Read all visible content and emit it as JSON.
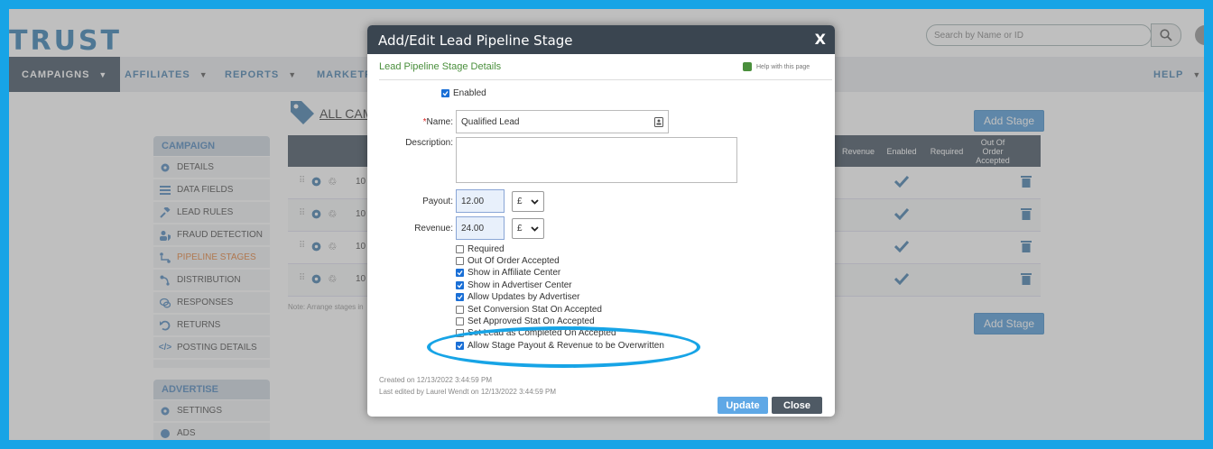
{
  "header": {
    "logo": "TRUST",
    "search_placeholder": "Search by Name or ID"
  },
  "nav": {
    "items": [
      {
        "label": "CAMPAIGNS",
        "active": true
      },
      {
        "label": "AFFILIATES"
      },
      {
        "label": "REPORTS"
      },
      {
        "label": "MARKETPL"
      },
      {
        "label": "HELP"
      }
    ]
  },
  "sidebar": {
    "campaign_head": "CAMPAIGN",
    "items": [
      {
        "label": "DETAILS",
        "icon": "gear-icon"
      },
      {
        "label": "DATA FIELDS",
        "icon": "list-icon"
      },
      {
        "label": "LEAD RULES",
        "icon": "gavel-icon"
      },
      {
        "label": "FRAUD DETECTION",
        "icon": "user-shield-icon"
      },
      {
        "label": "PIPELINE STAGES",
        "icon": "pipeline-icon",
        "active": true
      },
      {
        "label": "DISTRIBUTION",
        "icon": "distribution-icon"
      },
      {
        "label": "RESPONSES",
        "icon": "chat-icon"
      },
      {
        "label": "RETURNS",
        "icon": "return-icon"
      },
      {
        "label": "POSTING DETAILS",
        "icon": "code-icon"
      }
    ],
    "advertise_head": "ADVERTISE",
    "advertise_items": [
      {
        "label": "SETTINGS",
        "icon": "gear-icon"
      },
      {
        "label": "ADS",
        "icon": "palette-icon"
      }
    ]
  },
  "main": {
    "title": "ALL CAM",
    "add_stage": "Add Stage",
    "columns": {
      "revenue": "Revenue",
      "enabled": "Enabled",
      "required": "Required",
      "out_of_order": "Out Of Order Accepted"
    },
    "rows": [
      {
        "num": "10"
      },
      {
        "num": "10"
      },
      {
        "num": "10"
      },
      {
        "num": "10"
      }
    ],
    "note": "Note: Arrange stages in"
  },
  "modal": {
    "title": "Add/Edit Lead Pipeline Stage",
    "close": "X",
    "section": "Lead Pipeline Stage Details",
    "help": "Help with this page",
    "enabled_label": "Enabled",
    "name_label": "Name:",
    "name_required": "*",
    "name_value": "Qualified Lead",
    "description_label": "Description:",
    "payout_label": "Payout:",
    "payout_value": "12.00",
    "revenue_label": "Revenue:",
    "revenue_value": "24.00",
    "currency": "£",
    "checkboxes": [
      {
        "label": "Required",
        "checked": false
      },
      {
        "label": "Out Of Order Accepted",
        "checked": false
      },
      {
        "label": "Show in Affiliate Center",
        "checked": true
      },
      {
        "label": "Show in Advertiser Center",
        "checked": true
      },
      {
        "label": "Allow Updates by Advertiser",
        "checked": true
      },
      {
        "label": "Set Conversion Stat On Accepted",
        "checked": false
      },
      {
        "label": "Set Approved Stat On Accepted",
        "checked": false
      },
      {
        "label": "Set Lead as Completed On Accepted",
        "checked": false
      },
      {
        "label": "Allow Stage Payout & Revenue to be Overwritten",
        "checked": true
      }
    ],
    "created": "Created on 12/13/2022 3:44:59 PM",
    "edited": "Last edited by Laurel Wendt on 12/13/2022 3:44:59 PM",
    "update": "Update",
    "close_btn": "Close"
  },
  "colors": {
    "accent": "#17a4e6",
    "nav_dark": "#2c3e50",
    "link": "#2f6fa3",
    "section_green": "#4a8f3c"
  }
}
